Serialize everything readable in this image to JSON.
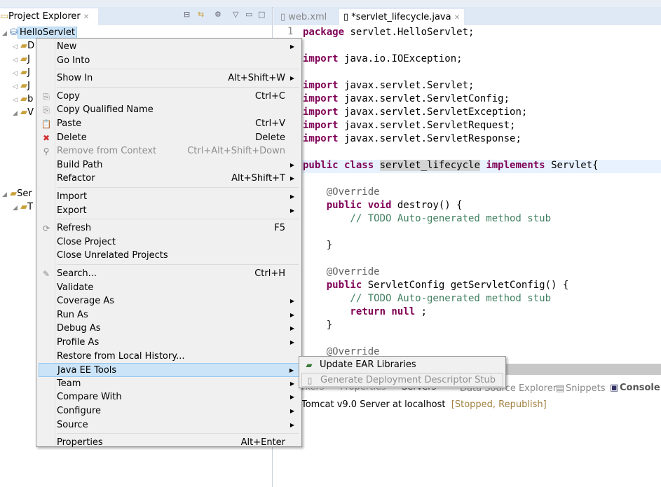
{
  "explorer": {
    "title": "Project Explorer",
    "project": "HelloServlet",
    "tree": [
      "D",
      "J",
      "J",
      "J",
      "b",
      "V",
      "Ser",
      "T"
    ]
  },
  "editor": {
    "tabs": [
      {
        "label": "web.xml"
      },
      {
        "label": "*servlet_lifecycle.java"
      }
    ],
    "lines": [
      {
        "n": "1",
        "parts": [
          [
            "kw",
            "package"
          ],
          [
            "",
            "servlet.HelloServlet;"
          ]
        ]
      },
      {
        "parts": []
      },
      {
        "parts": [
          [
            "kw",
            "import"
          ],
          [
            "",
            "java.io.IOException;"
          ]
        ]
      },
      {
        "parts": []
      },
      {
        "parts": [
          [
            "kw",
            "import"
          ],
          [
            "",
            "javax.servlet.Servlet;"
          ]
        ]
      },
      {
        "parts": [
          [
            "kw",
            "import"
          ],
          [
            "",
            "javax.servlet.ServletConfig;"
          ]
        ]
      },
      {
        "parts": [
          [
            "kw",
            "import"
          ],
          [
            "",
            "javax.servlet.ServletException;"
          ]
        ]
      },
      {
        "parts": [
          [
            "kw",
            "import"
          ],
          [
            "",
            "javax.servlet.ServletRequest;"
          ]
        ]
      },
      {
        "parts": [
          [
            "kw",
            "import"
          ],
          [
            "",
            "javax.servlet.ServletResponse;"
          ]
        ]
      },
      {
        "parts": []
      },
      {
        "parts": [
          [
            "kw",
            "public class"
          ],
          [
            "hl",
            "servlet_lifecycle"
          ],
          [
            "kw",
            "implements"
          ],
          [
            "",
            "Servlet{"
          ]
        ]
      },
      {
        "parts": []
      },
      {
        "parts": [
          [
            "an",
            "    @Override"
          ]
        ]
      },
      {
        "parts": [
          [
            "kw",
            "    public void"
          ],
          [
            "",
            "destroy() {"
          ]
        ]
      },
      {
        "parts": [
          [
            "cm",
            "        // TODO Auto-generated method stub"
          ]
        ]
      },
      {
        "parts": []
      },
      {
        "parts": [
          [
            "",
            "    }"
          ]
        ]
      },
      {
        "parts": []
      },
      {
        "parts": [
          [
            "an",
            "    @Override"
          ]
        ]
      },
      {
        "parts": [
          [
            "kw",
            "    public"
          ],
          [
            "",
            "ServletConfig getServletConfig() {"
          ]
        ]
      },
      {
        "parts": [
          [
            "cm",
            "        // TODO Auto-generated method stub"
          ]
        ]
      },
      {
        "parts": [
          [
            "kw",
            "        return null"
          ],
          [
            "",
            ";"
          ]
        ]
      },
      {
        "parts": [
          [
            "",
            "    }"
          ]
        ]
      },
      {
        "parts": []
      },
      {
        "parts": [
          [
            "an",
            "    @Override"
          ]
        ]
      }
    ]
  },
  "bottom": {
    "tabs": [
      "rkers",
      "Properties",
      "Servers",
      "Data Source Explorer",
      "Snippets",
      "Console"
    ],
    "server": "Tomcat v9.0 Server at localhost",
    "status": "[Stopped, Republish]"
  },
  "menu": {
    "items": [
      {
        "label": "New",
        "arrow": true
      },
      {
        "label": "Go Into"
      },
      {
        "sep": true
      },
      {
        "label": "Show In",
        "shortcut": "Alt+Shift+W",
        "arrow": true
      },
      {
        "sep": true
      },
      {
        "label": "Copy",
        "shortcut": "Ctrl+C",
        "icon": "copy-icon",
        "glyph": "⎘"
      },
      {
        "label": "Copy Qualified Name",
        "icon": "copy-qualified-icon",
        "glyph": "⎘"
      },
      {
        "label": "Paste",
        "shortcut": "Ctrl+V",
        "icon": "paste-icon",
        "glyph": "📋"
      },
      {
        "label": "Delete",
        "shortcut": "Delete",
        "icon": "delete-icon",
        "glyph": "✖"
      },
      {
        "label": "Remove from Context",
        "shortcut": "Ctrl+Alt+Shift+Down",
        "disabled": true,
        "icon": "remove-context-icon",
        "glyph": "⚲"
      },
      {
        "label": "Build Path",
        "arrow": true
      },
      {
        "label": "Refactor",
        "shortcut": "Alt+Shift+T",
        "arrow": true
      },
      {
        "sep": true
      },
      {
        "label": "Import",
        "arrow": true
      },
      {
        "label": "Export",
        "arrow": true
      },
      {
        "sep": true
      },
      {
        "label": "Refresh",
        "shortcut": "F5",
        "icon": "refresh-icon",
        "glyph": "⟳"
      },
      {
        "label": "Close Project"
      },
      {
        "label": "Close Unrelated Projects"
      },
      {
        "sep": true
      },
      {
        "label": "Search...",
        "shortcut": "Ctrl+H",
        "icon": "search-icon",
        "glyph": "✎"
      },
      {
        "label": "Validate"
      },
      {
        "label": "Coverage As",
        "arrow": true
      },
      {
        "label": "Run As",
        "arrow": true
      },
      {
        "label": "Debug As",
        "arrow": true
      },
      {
        "label": "Profile As",
        "arrow": true
      },
      {
        "label": "Restore from Local History..."
      },
      {
        "label": "Java EE Tools",
        "arrow": true,
        "selected": true
      },
      {
        "label": "Team",
        "arrow": true
      },
      {
        "label": "Compare With",
        "arrow": true
      },
      {
        "label": "Configure",
        "arrow": true
      },
      {
        "label": "Source",
        "arrow": true
      },
      {
        "sep": true
      },
      {
        "label": "Properties",
        "shortcut": "Alt+Enter"
      }
    ]
  },
  "submenu": {
    "items": [
      {
        "label": "Update EAR Libraries"
      },
      {
        "label": "Generate Deployment Descriptor Stub",
        "disabled": true
      }
    ]
  },
  "colors": {
    "keyword": "#7f0055",
    "comment": "#3f7f5f",
    "selection": "#cce4f7",
    "status": "#a08040"
  }
}
